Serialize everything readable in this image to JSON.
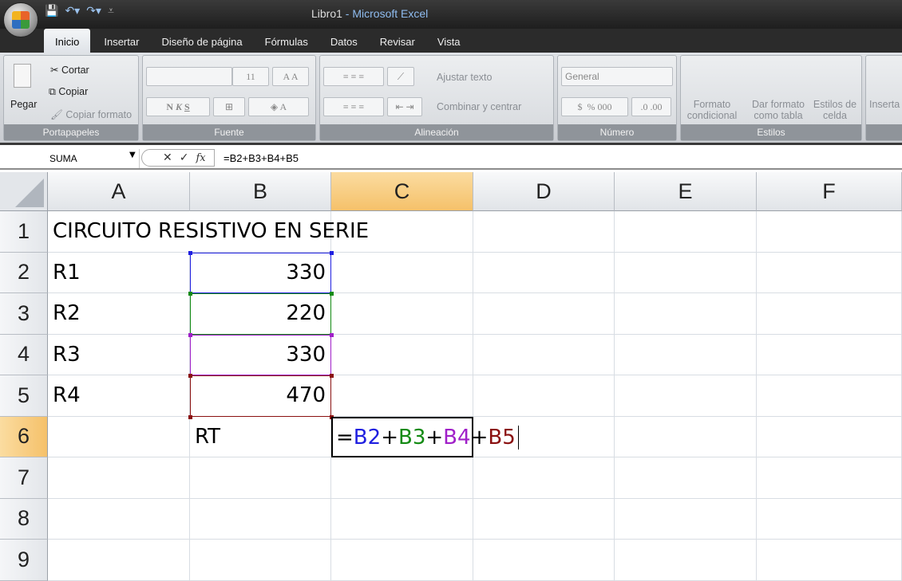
{
  "window": {
    "title": "Libro1",
    "app": " - Microsoft Excel"
  },
  "tabs": [
    "Inicio",
    "Insertar",
    "Diseño de página",
    "Fórmulas",
    "Datos",
    "Revisar",
    "Vista"
  ],
  "ribbon": {
    "clipboard": {
      "paste": "Pegar",
      "cut": "Cortar",
      "copy": "Copiar",
      "format_painter": "Copiar formato",
      "label": "Portapapeles"
    },
    "font": {
      "size": "11",
      "bold": "N",
      "italic": "K",
      "underline": "S",
      "label": "Fuente"
    },
    "alignment": {
      "wrap": "Ajustar texto",
      "merge": "Combinar y centrar",
      "label": "Alineación"
    },
    "number": {
      "format": "General",
      "currency": "$",
      "percent": "%",
      "thousands": "000",
      "label": "Número"
    },
    "styles": {
      "conditional": "Formato condicional",
      "table": "Dar formato como tabla",
      "cell_styles": "Estilos de celda",
      "label": "Estilos"
    },
    "cells": {
      "insert": "Inserta"
    }
  },
  "formula_bar": {
    "name_box": "SUMA",
    "fx": "fx",
    "formula": "=B2+B3+B4+B5"
  },
  "columns": [
    "A",
    "B",
    "C",
    "D",
    "E",
    "F"
  ],
  "rows": [
    "1",
    "2",
    "3",
    "4",
    "5",
    "6",
    "7",
    "8",
    "9"
  ],
  "cells": {
    "A1": "CIRCUITO RESISTIVO EN SERIE",
    "A2": "R1",
    "B2": "330",
    "A3": "R2",
    "B3": "220",
    "A4": "R3",
    "B4": "330",
    "A5": "R4",
    "B5": "470",
    "B6": "RT"
  },
  "edit": {
    "eq": "=",
    "r1": "B2",
    "p1": "+",
    "r2": "B3",
    "p2": "+",
    "r3": "B4",
    "p3": "+",
    "r4": "B5"
  },
  "colors": {
    "ref1": "#1f1fe0",
    "ref2": "#128a12",
    "ref3": "#a020c8",
    "ref4": "#8a1010",
    "selected_header": "#f5c16a"
  }
}
